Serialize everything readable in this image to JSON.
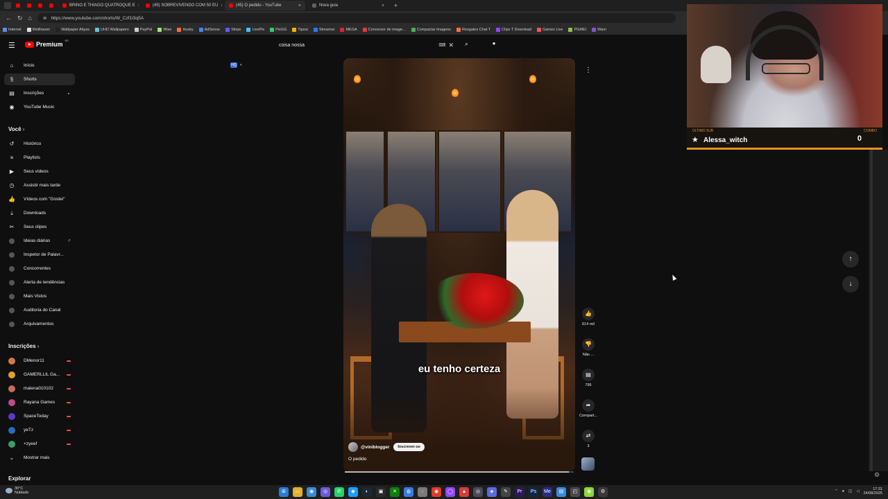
{
  "browser": {
    "tabs": [
      {
        "label": "",
        "small": true,
        "color": "#ff0000"
      },
      {
        "label": "",
        "small": true,
        "color": "#ff0000"
      },
      {
        "label": "",
        "small": true,
        "color": "#ff0000"
      },
      {
        "label": "",
        "small": true,
        "color": "#ff0000"
      },
      {
        "label": "BRINO E THIAGO QUATROQUE E",
        "small": false,
        "color": "#ff0000"
      },
      {
        "label": "(45) SOBREVIVENDO COM 50 EU",
        "small": false,
        "color": "#ff0000"
      },
      {
        "label": "(45) O pedido - YouTube",
        "small": false,
        "color": "#ff0000",
        "active": true
      },
      {
        "label": "Nova guia",
        "small": false,
        "color": "#5f6368"
      }
    ],
    "url": "https://www.youtube.com/shorts/W_Czf1I3q5A",
    "bookmarks": [
      {
        "label": "Internet",
        "color": "#5b8def"
      },
      {
        "label": "Wellhaven",
        "color": "#e0e0e0"
      },
      {
        "label": "Wallpaper Abyss",
        "color": "#222222"
      },
      {
        "label": "UHD Wallpapers",
        "color": "#6ac0e0"
      },
      {
        "label": "PayPal",
        "color": "#cccccc"
      },
      {
        "label": "Wise",
        "color": "#9fe870"
      },
      {
        "label": "Husky",
        "color": "#ff6a3a"
      },
      {
        "label": "AdSense",
        "color": "#4285f4"
      },
      {
        "label": "Stripe",
        "color": "#635bff"
      },
      {
        "label": "LivePix",
        "color": "#40c4ff"
      },
      {
        "label": "PixGG",
        "color": "#33cc66"
      },
      {
        "label": "Tipzai",
        "color": "#ffb300"
      },
      {
        "label": "Streamar",
        "color": "#2979ff"
      },
      {
        "label": "MEGA",
        "color": "#d9272e"
      },
      {
        "label": "Conversor de image...",
        "color": "#e53935"
      },
      {
        "label": "Compactar imagens",
        "color": "#4caf50"
      },
      {
        "label": "Resgates Chat T",
        "color": "#ff7043"
      },
      {
        "label": "Clips T Download",
        "color": "#9146ff"
      },
      {
        "label": "Games Live",
        "color": "#ff5252"
      },
      {
        "label": "PGMEI",
        "color": "#8bc34a"
      },
      {
        "label": "Warn",
        "color": "#7e57c2"
      }
    ]
  },
  "header": {
    "logo_text": "Premium",
    "logo_country": "BR",
    "search_value": "coisa nossa",
    "keyboard_icon": "⌨",
    "clear_icon": "✕",
    "search_icon": "⌕",
    "mic_icon": "🎙"
  },
  "sidebar": {
    "main": [
      {
        "label": "Início",
        "icon": "⌂"
      },
      {
        "label": "Shorts",
        "icon": "§",
        "active": true
      },
      {
        "label": "Inscrições",
        "icon": "▤",
        "badge": true
      },
      {
        "label": "YouTube Music",
        "icon": "◉"
      }
    ],
    "you_title": "Você",
    "you": [
      {
        "label": "Histórico",
        "icon": "↺"
      },
      {
        "label": "Playlists",
        "icon": "≡"
      },
      {
        "label": "Seus vídeos",
        "icon": "▶"
      },
      {
        "label": "Assistir mais tarde",
        "icon": "◷"
      },
      {
        "label": "Vídeos com \"Gostei\"",
        "icon": "👍"
      },
      {
        "label": "Downloads",
        "icon": "⤓"
      },
      {
        "label": "Seus clipes",
        "icon": "✂"
      },
      {
        "label": "Ideias diárias",
        "icon": "",
        "dot": true,
        "ext": true
      },
      {
        "label": "Inspetor de Palavr...",
        "icon": "",
        "dot": true
      },
      {
        "label": "Concorrentes",
        "icon": "",
        "dot": true
      },
      {
        "label": "Alerta de tendências",
        "icon": "",
        "dot": true
      },
      {
        "label": "Mais Vistos",
        "icon": "",
        "dot": true
      },
      {
        "label": "Auditoria do Canal",
        "icon": "",
        "dot": true
      },
      {
        "label": "Arquivamentos",
        "icon": "",
        "dot": true
      }
    ],
    "subs_title": "Inscrições",
    "subs": [
      {
        "label": "DMenor11",
        "color": "#d07a4a"
      },
      {
        "label": "GAMERLLIL Ga...",
        "color": "#e0a030"
      },
      {
        "label": "malena010102",
        "color": "#c86a5a"
      },
      {
        "label": "Rayana Games",
        "color": "#c04a8a"
      },
      {
        "label": "SpaceToday",
        "color": "#5a3ac8"
      },
      {
        "label": "yeTz",
        "color": "#2a6ac0"
      },
      {
        "label": "+zyeef",
        "color": "#3aa06a"
      }
    ],
    "show_more": "Mostrar mais",
    "explore_title": "Explorar"
  },
  "short": {
    "caption": "eu tenho certeza",
    "channel": "@viniblogger",
    "subscribe": "Inscrever-se",
    "title": "O pedido",
    "progress_fraction": 0.98
  },
  "actions": {
    "like_icon": "👍",
    "like_count": "614 mil",
    "dislike_icon": "👎",
    "dislike_label": "Não ...",
    "comment_icon": "▤",
    "comment_count": "795",
    "share_icon": "➦",
    "share_label": "Compart...",
    "remix_icon": "⇄",
    "remix_count": "3",
    "more_icon": "⋮"
  },
  "nav": {
    "up_icon": "↑",
    "down_icon": "↓"
  },
  "overlay": {
    "last_sub_label": "ÚLTIMO SUB",
    "last_sub_name": "Alessa_witch",
    "combo_label": "COMBO",
    "combo_value": "0"
  },
  "taskbar": {
    "temp": "30°C",
    "weather": "Nublado",
    "apps": [
      {
        "icon": "⊞",
        "color": "#2a7ad8"
      },
      {
        "icon": "▭",
        "color": "#e0b030"
      },
      {
        "icon": "◉",
        "color": "#3a8ad8"
      },
      {
        "icon": "◎",
        "color": "#6a5ad8"
      },
      {
        "icon": "✆",
        "color": "#25d366"
      },
      {
        "icon": "◆",
        "color": "#1a9fff"
      },
      {
        "icon": "◐",
        "color": "#1b2838"
      },
      {
        "icon": "▣",
        "color": "#2a2a2a"
      },
      {
        "icon": "✕",
        "color": "#107c10"
      },
      {
        "icon": "◍",
        "color": "#3a7ae0"
      },
      {
        "icon": "◌",
        "color": "#7a7a7a"
      },
      {
        "icon": "◉",
        "color": "#e03a2a"
      },
      {
        "icon": "◯",
        "color": "#9146ff"
      },
      {
        "icon": "▲",
        "color": "#d83a3a"
      },
      {
        "icon": "◎",
        "color": "#4a4a5a"
      },
      {
        "icon": "◈",
        "color": "#5a6ae0"
      },
      {
        "icon": "✎",
        "color": "#444444"
      },
      {
        "icon": "Pr",
        "color": "#2a1a5a"
      },
      {
        "icon": "Ps",
        "color": "#0a2a4a"
      },
      {
        "icon": "Me",
        "color": "#2a2a8a"
      },
      {
        "icon": "▤",
        "color": "#3a8ae0"
      },
      {
        "icon": "◰",
        "color": "#4a4a4a"
      },
      {
        "icon": "◉",
        "color": "#8ad83a"
      },
      {
        "icon": "⚙",
        "color": "#3a3a3a"
      }
    ],
    "time": "17:31",
    "date": "24/08/2025"
  },
  "studio_icon": "⚙"
}
